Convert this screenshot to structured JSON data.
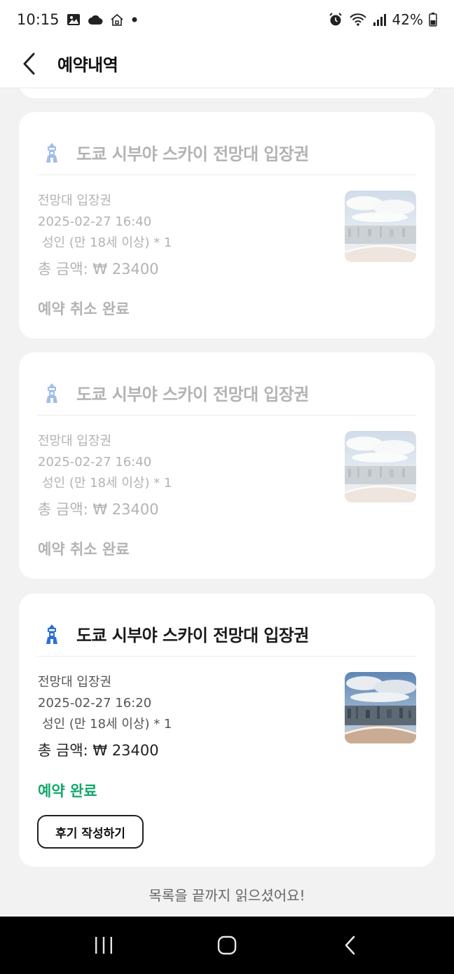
{
  "status_bar": {
    "time": "10:15",
    "battery": "42%",
    "left_icons": [
      "gallery-icon",
      "cloud-icon",
      "home-icon",
      "notification-dot-icon"
    ],
    "right_icons": [
      "alarm-icon",
      "wifi-icon",
      "signal-icon",
      "battery-icon"
    ]
  },
  "header": {
    "title": "예약내역",
    "back_icon": "chevron-left-icon"
  },
  "reservations": [
    {
      "title": "도쿄 시부야 스카이 전망대 입장권",
      "ticket_type": "전망대 입장권",
      "datetime": "2025-02-27 16:40",
      "guests": "성인 (만 18세 이상) * 1",
      "total": "총 금액: ₩ 23400",
      "status": "예약 취소 완료",
      "faded": true
    },
    {
      "title": "도쿄 시부야 스카이 전망대 입장권",
      "ticket_type": "전망대 입장권",
      "datetime": "2025-02-27 16:40",
      "guests": "성인 (만 18세 이상) * 1",
      "total": "총 금액: ₩ 23400",
      "status": "예약 취소 완료",
      "faded": true
    },
    {
      "title": "도쿄 시부야 스카이 전망대 입장권",
      "ticket_type": "전망대 입장권",
      "datetime": "2025-02-27 16:20",
      "guests": "성인 (만 18세 이상) * 1",
      "total": "총 금액: ₩ 23400",
      "status": "예약 완료",
      "faded": false,
      "review_button": "후기 작성하기"
    }
  ],
  "end_message": "목록을 끝까지 읽으셨어요!",
  "colors": {
    "confirmed_status": "#12a86a",
    "faded_text": "#b3b3b3",
    "page_background": "#f2f2f2",
    "icon_blue": "#2f6fd6"
  },
  "nav_bar": {
    "buttons": [
      "recent-apps-icon",
      "home-button-icon",
      "back-icon"
    ]
  }
}
